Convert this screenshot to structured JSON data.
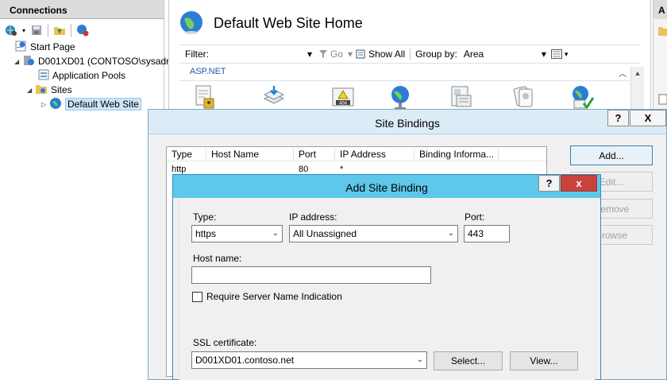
{
  "connections": {
    "header": "Connections",
    "toolbar_icons": [
      "connect-icon",
      "dropdown-icon",
      "save-icon",
      "up-folder-icon",
      "disconnect-icon"
    ],
    "tree": [
      {
        "label": "Start Page",
        "icon": "start-page-icon",
        "expander": ""
      },
      {
        "label": "D001XD01 (CONTOSO\\sysadr",
        "icon": "server-icon",
        "expander": "◢"
      },
      {
        "label": "Application Pools",
        "icon": "app-pools-icon",
        "expander": ""
      },
      {
        "label": "Sites",
        "icon": "sites-folder-icon",
        "expander": "◢"
      },
      {
        "label": "Default Web Site",
        "icon": "globe-icon",
        "expander": "▷",
        "selected": true
      }
    ]
  },
  "center": {
    "title": "Default Web Site Home",
    "filter_label": "Filter:",
    "go_label": "Go",
    "show_all_label": "Show All",
    "group_by_label": "Group by:",
    "group_by_value": "Area",
    "section_label": "ASP.NET",
    "feature_icons": [
      ".NET Authorization Rules",
      ".NET Compilation",
      ".NET Error Pages",
      ".NET Globalization",
      ".NET Profile",
      ".NET Roles",
      ".NET Trust Levels"
    ]
  },
  "actions": {
    "header": "A"
  },
  "site_bindings": {
    "title": "Site Bindings",
    "help": "?",
    "close": "X",
    "columns": [
      "Type",
      "Host Name",
      "Port",
      "IP Address",
      "Binding Informa..."
    ],
    "rows": [
      {
        "type": "http",
        "host": "",
        "port": "80",
        "ip": "*",
        "info": ""
      }
    ],
    "buttons": {
      "add": "Add...",
      "edit": "Edit...",
      "remove": "Remove",
      "browse": "Browse"
    }
  },
  "add_site_binding": {
    "title": "Add Site Binding",
    "help": "?",
    "close": "x",
    "type_label": "Type:",
    "type_value": "https",
    "ip_label": "IP address:",
    "ip_value": "All Unassigned",
    "port_label": "Port:",
    "port_value": "443",
    "host_label": "Host name:",
    "host_value": "",
    "sni_label": "Require Server Name Indication",
    "sni_checked": false,
    "ssl_label": "SSL certificate:",
    "ssl_value": "D001XD01.contoso.net",
    "select_button": "Select...",
    "view_button": "View..."
  }
}
